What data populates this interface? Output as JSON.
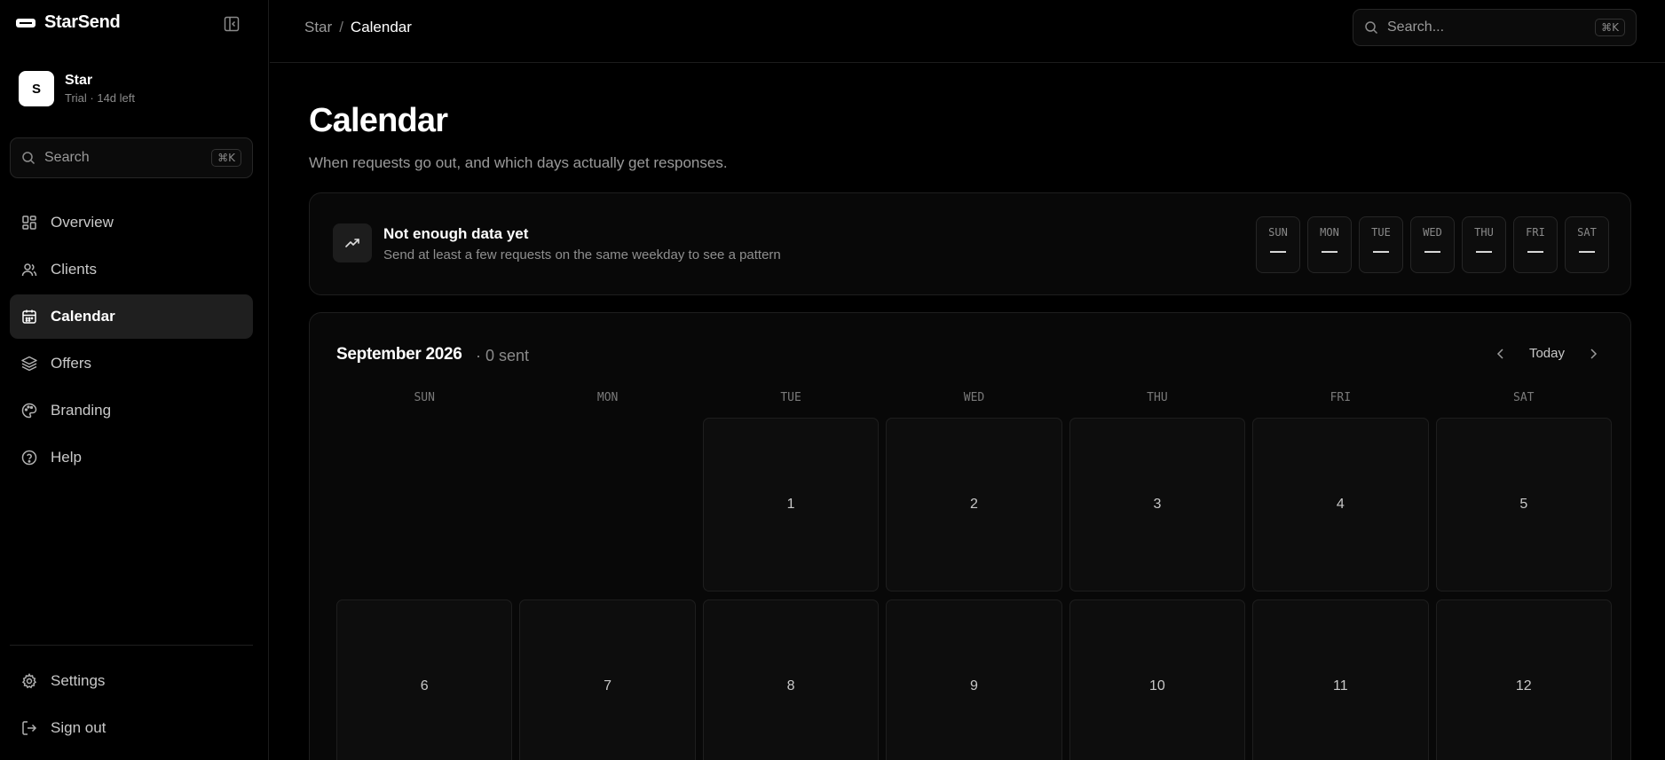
{
  "brand": {
    "name": "StarSend"
  },
  "account": {
    "initial": "S",
    "name": "Star",
    "subtitle": "Trial · 14d left"
  },
  "sidebar": {
    "search_placeholder": "Search",
    "search_shortcut": "⌘K",
    "items": [
      {
        "label": "Overview",
        "icon": "grid-icon"
      },
      {
        "label": "Clients",
        "icon": "users-icon"
      },
      {
        "label": "Calendar",
        "icon": "calendar-icon",
        "active": true
      },
      {
        "label": "Offers",
        "icon": "layers-icon"
      },
      {
        "label": "Branding",
        "icon": "palette-icon"
      },
      {
        "label": "Help",
        "icon": "help-circle-icon"
      }
    ],
    "bottom_items": [
      {
        "label": "Settings",
        "icon": "gear-icon"
      },
      {
        "label": "Sign out",
        "icon": "sign-out-icon"
      }
    ]
  },
  "topbar": {
    "breadcrumb": [
      "Star",
      "/",
      "Calendar"
    ],
    "search_placeholder": "Search...",
    "search_shortcut": "⌘K"
  },
  "page": {
    "title": "Calendar",
    "subtitle": "When requests go out, and which days actually get responses."
  },
  "insight": {
    "icon": "trending-up-icon",
    "title": "Not enough data yet",
    "subtitle": "Send at least a few requests on the same weekday to see a pattern",
    "weekdays": [
      {
        "day": "SUN",
        "value": "—"
      },
      {
        "day": "MON",
        "value": "—"
      },
      {
        "day": "TUE",
        "value": "—"
      },
      {
        "day": "WED",
        "value": "—"
      },
      {
        "day": "THU",
        "value": "—"
      },
      {
        "day": "FRI",
        "value": "—"
      },
      {
        "day": "SAT",
        "value": "—"
      }
    ]
  },
  "calendar": {
    "month": "September 2026",
    "meta": "· 0 sent",
    "today_label": "Today",
    "weekday_headers": [
      "SUN",
      "MON",
      "TUE",
      "WED",
      "THU",
      "FRI",
      "SAT"
    ],
    "days": [
      "",
      "",
      "1",
      "2",
      "3",
      "4",
      "5",
      "6",
      "7",
      "8",
      "9",
      "10",
      "11",
      "12"
    ]
  }
}
